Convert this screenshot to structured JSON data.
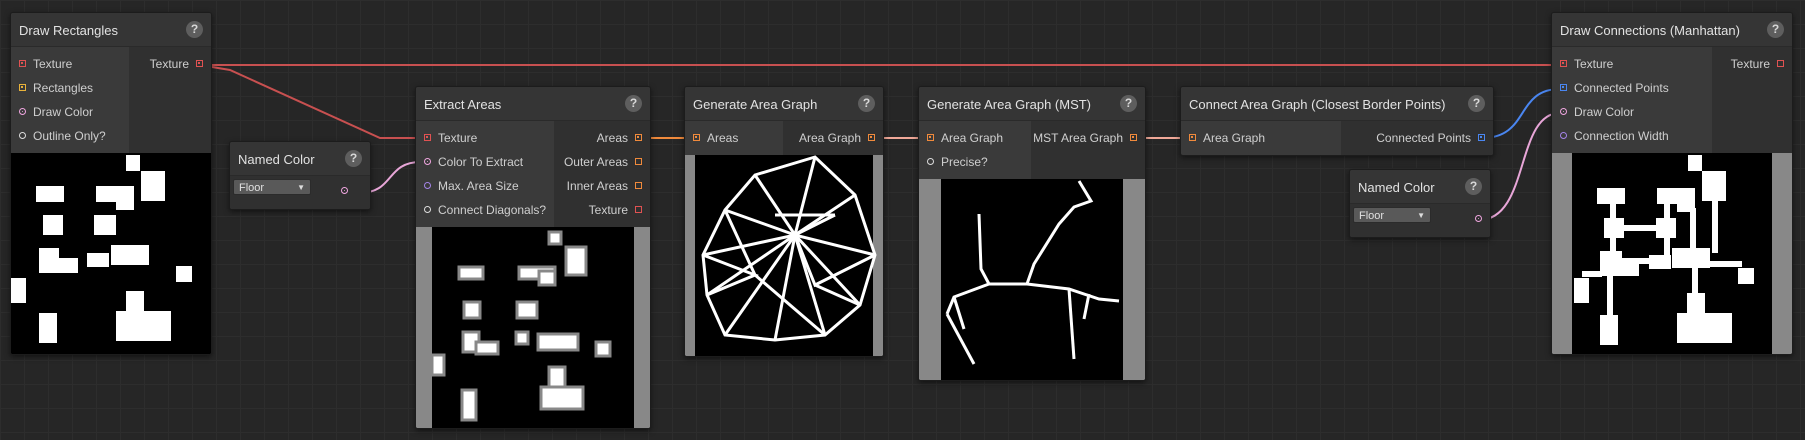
{
  "colors": {
    "texture": "#e05252",
    "areas": "#f08a3c",
    "rectangles": "#e8b23a",
    "color": "#f0a6e0",
    "bool": "#dcdcdc",
    "float": "#a484e8",
    "points": "#4a86f0"
  },
  "help_label": "?",
  "nodes": {
    "draw_rectangles": {
      "title": "Draw Rectangles",
      "inputs": [
        "Texture",
        "Rectangles",
        "Draw Color",
        "Outline Only?"
      ],
      "output": "Texture"
    },
    "named_color_1": {
      "title": "Named Color",
      "dropdown": "Floor"
    },
    "extract_areas": {
      "title": "Extract Areas",
      "inputs": [
        "Texture",
        "Color To Extract",
        "Max. Area Size",
        "Connect Diagonals?"
      ],
      "outputs": [
        "Areas",
        "Outer Areas",
        "Inner Areas",
        "Texture"
      ]
    },
    "generate_area_graph": {
      "title": "Generate Area Graph",
      "input": "Areas",
      "output": "Area Graph"
    },
    "generate_area_graph_mst": {
      "title": "Generate Area Graph (MST)",
      "inputs": [
        "Area Graph",
        "Precise?"
      ],
      "output": "MST Area Graph"
    },
    "connect_area_graph": {
      "title": "Connect Area Graph (Closest Border Points)",
      "input": "Area Graph",
      "output": "Connected Points"
    },
    "named_color_2": {
      "title": "Named Color",
      "dropdown": "Floor"
    },
    "draw_connections": {
      "title": "Draw Connections (Manhattan)",
      "inputs": [
        "Texture",
        "Connected Points",
        "Draw Color",
        "Connection Width"
      ],
      "output": "Texture"
    }
  }
}
